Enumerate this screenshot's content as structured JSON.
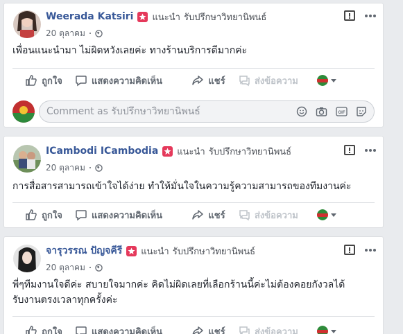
{
  "posts": [
    {
      "author": "Weerada Katsiri",
      "recommends": "แนะนำ",
      "page": "รับปรึกษาวิทยานิพนธ์",
      "date": "20 ตุลาคม",
      "text_lines": [
        "เพื่อนแนะนำมา ไม่ผิดหวังเลยค่ะ ทางร้านบริการดีมากค่ะ"
      ],
      "show_comment_box": true
    },
    {
      "author": "ICambodi ICambodia",
      "recommends": "แนะนำ",
      "page": "รับปรึกษาวิทยานิพนธ์",
      "date": "20 ตุลาคม",
      "text_lines": [
        "การสื่อสารสามารถเข้าใจได้ง่าย ทำให้มั่นใจในความรู้ความสามารถของทีมงานค่ะ"
      ],
      "show_comment_box": false
    },
    {
      "author": "จารุวรรณ ปัญจคีรี",
      "recommends": "แนะนำ",
      "page": "รับปรึกษาวิทยานิพนธ์",
      "date": "20 ตุลาคม",
      "text_lines": [
        "พี่ๆทีมงานใจดีค่ะ สบายใจมากค่ะ คิดไม่ผิดเลยที่เลือกร้านนี้ค่ะไม่ต้องคอยกังวลได้",
        "รับงานตรงเวลาทุกครั้งค่ะ"
      ],
      "show_comment_box": false
    }
  ],
  "actions": {
    "like": "ถูกใจ",
    "comment": "แสดงความคิดเห็น",
    "share": "แชร์",
    "message": "ส่งข้อความ"
  },
  "comment_box": {
    "placeholder": "Comment as รับปรึกษาวิทยานิพนธ์"
  },
  "colors": {
    "name": "#385898",
    "badge": "#e5395b",
    "text": "#1d2129",
    "muted": "#606770"
  }
}
